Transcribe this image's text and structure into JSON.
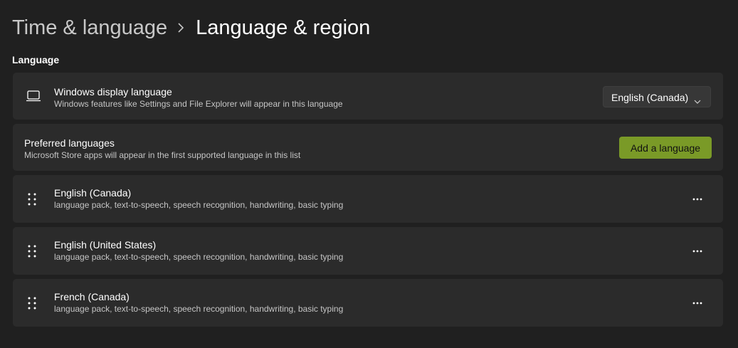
{
  "breadcrumb": {
    "parent": "Time & language",
    "current": "Language & region"
  },
  "section": {
    "label": "Language"
  },
  "display_language": {
    "icon": "laptop-icon",
    "title": "Windows display language",
    "subtitle": "Windows features like Settings and File Explorer will appear in this language",
    "selected": "English (Canada)"
  },
  "preferred_languages": {
    "title": "Preferred languages",
    "subtitle": "Microsoft Store apps will appear in the first supported language in this list",
    "add_label": "Add a language"
  },
  "languages": [
    {
      "name": "English (Canada)",
      "features": "language pack, text-to-speech, speech recognition, handwriting, basic typing"
    },
    {
      "name": "English (United States)",
      "features": "language pack, text-to-speech, speech recognition, handwriting, basic typing"
    },
    {
      "name": "French (Canada)",
      "features": "language pack, text-to-speech, speech recognition, handwriting, basic typing"
    }
  ],
  "colors": {
    "background": "#202020",
    "card": "#2b2b2b",
    "accent": "#7a9a27"
  }
}
